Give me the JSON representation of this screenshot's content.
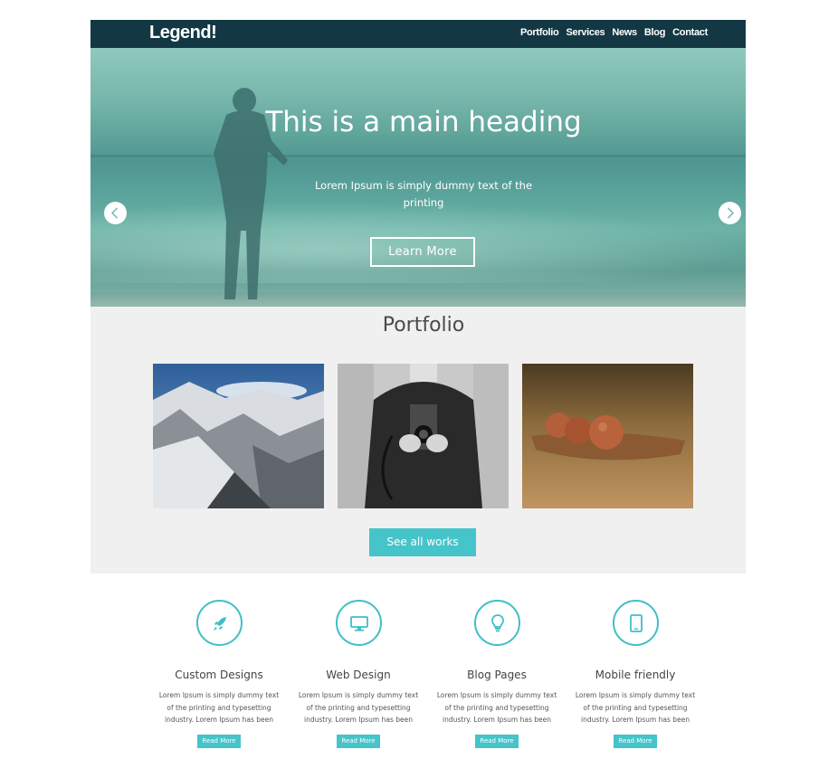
{
  "header": {
    "logo": "Legend!",
    "nav": [
      "Portfolio",
      "Services",
      "News",
      "Blog",
      "Contact"
    ]
  },
  "hero": {
    "heading": "This is a main heading",
    "subtext": "Lorem Ipsum is simply dummy text of the printing",
    "button": "Learn More",
    "prev_icon": "chevron-left-icon",
    "next_icon": "chevron-right-icon"
  },
  "portfolio": {
    "title": "Portfolio",
    "images": [
      "snowy-mountains",
      "person-holding-camera",
      "seed-pods-on-leaf"
    ],
    "button": "See all works"
  },
  "features": [
    {
      "icon": "rocket-icon",
      "title": "Custom Designs",
      "text": "Lorem Ipsum is simply dummy text of the printing and typesetting industry. Lorem Ipsum has been",
      "button": "Read More"
    },
    {
      "icon": "monitor-icon",
      "title": "Web Design",
      "text": "Lorem Ipsum is simply dummy text of the printing and typesetting industry. Lorem Ipsum has been",
      "button": "Read More"
    },
    {
      "icon": "lightbulb-icon",
      "title": "Blog Pages",
      "text": "Lorem Ipsum is simply dummy text of the printing and typesetting industry. Lorem Ipsum has been",
      "button": "Read More"
    },
    {
      "icon": "tablet-icon",
      "title": "Mobile friendly",
      "text": "Lorem Ipsum is simply dummy text of the printing and typesetting industry. Lorem Ipsum has been",
      "button": "Read More"
    }
  ],
  "colors": {
    "header_bg": "#133844",
    "accent": "#45c4ca",
    "section_bg": "#f0f0f0"
  }
}
